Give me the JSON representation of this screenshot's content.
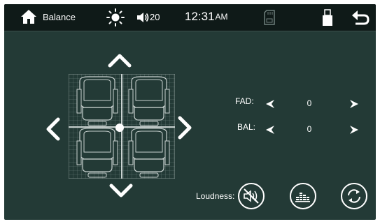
{
  "topbar": {
    "title": "Balance",
    "volume": "20",
    "time": "12:31",
    "ampm": "AM"
  },
  "controls": {
    "fad_label": "FAD:",
    "fad_value": "0",
    "bal_label": "BAL:",
    "bal_value": "0",
    "loudness_label": "Loudness:"
  },
  "icons": {
    "home": "home-icon",
    "brightness": "sun-icon",
    "volume": "speaker-icon",
    "sd": "sd-card-icon",
    "usb": "usb-icon",
    "back": "back-icon",
    "loudness": "loudness-muted-icon",
    "eq": "equalizer-icon",
    "reset": "reset-icon"
  },
  "colors": {
    "background": "#233a36",
    "topbar": "#0f1a18",
    "accent": "#ffffff"
  }
}
